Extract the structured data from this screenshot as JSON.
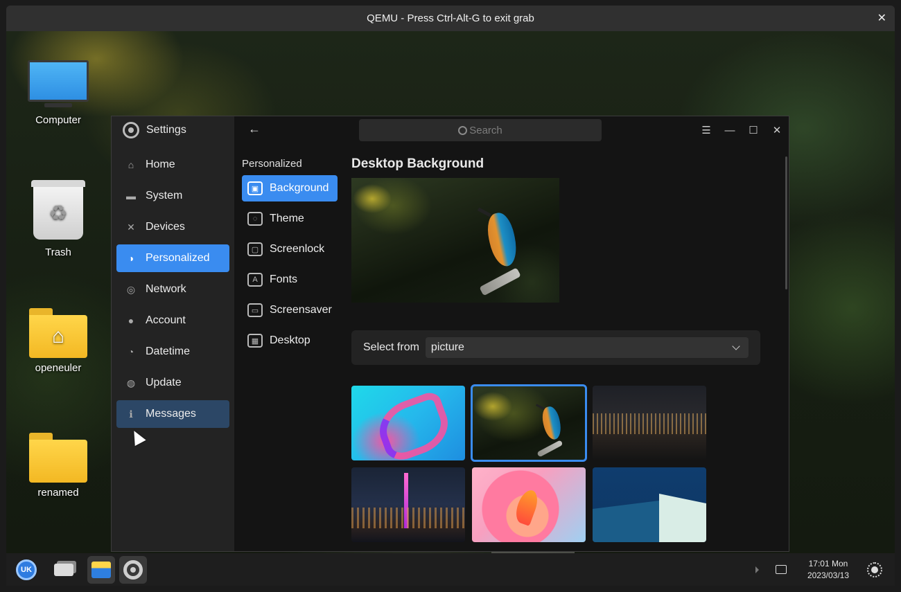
{
  "qemu": {
    "title": "QEMU - Press Ctrl-Alt-G to exit grab",
    "close_icon": "✕"
  },
  "desktop": {
    "icons": [
      {
        "label": "Computer",
        "icon": "computer-icon"
      },
      {
        "label": "Trash",
        "icon": "trash-icon"
      },
      {
        "label": "openeuler",
        "icon": "home-folder-icon"
      },
      {
        "label": "renamed",
        "icon": "folder-icon"
      }
    ]
  },
  "settings": {
    "app_title": "Settings",
    "search_placeholder": "Search",
    "nav": [
      {
        "label": "Home",
        "icon": "⌂"
      },
      {
        "label": "System",
        "icon": "▬"
      },
      {
        "label": "Devices",
        "icon": "✕"
      },
      {
        "label": "Personalized",
        "icon": "◑"
      },
      {
        "label": "Network",
        "icon": "◎"
      },
      {
        "label": "Account",
        "icon": "●"
      },
      {
        "label": "Datetime",
        "icon": "◔"
      },
      {
        "label": "Update",
        "icon": "◍"
      },
      {
        "label": "Messages",
        "icon": "ℹ"
      }
    ],
    "nav_active": "Personalized",
    "sub_title": "Personalized",
    "sub_items": [
      {
        "label": "Background",
        "icon": "▣"
      },
      {
        "label": "Theme",
        "icon": "◌"
      },
      {
        "label": "Screenlock",
        "icon": "▢"
      },
      {
        "label": "Fonts",
        "icon": "A"
      },
      {
        "label": "Screensaver",
        "icon": "▭"
      },
      {
        "label": "Desktop",
        "icon": "▦"
      }
    ],
    "content": {
      "title": "Desktop Background",
      "select_label": "Select from",
      "select_value": "picture"
    }
  },
  "taskbar": {
    "start_label": "UK",
    "clock_time": "17:01 Mon",
    "clock_date": "2023/03/13"
  },
  "colors": {
    "accent": "#3a8cf0",
    "window_bg": "#141414",
    "nav_bg": "#232323"
  }
}
